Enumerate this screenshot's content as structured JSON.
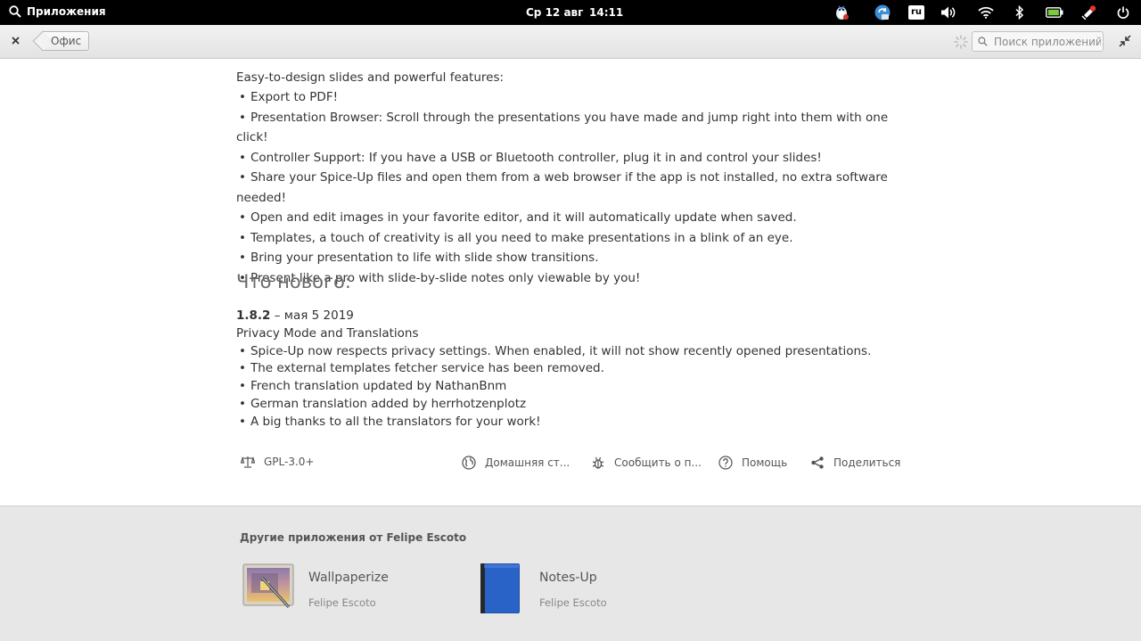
{
  "panel": {
    "apps_label": "Приложения",
    "date": "Ср 12 авг",
    "time": "14:11",
    "lang": "ru"
  },
  "header": {
    "back_label": "Офис",
    "search_placeholder": "Поиск приложений"
  },
  "description": {
    "intro": "Easy-to-design slides and powerful features:",
    "features": [
      "Export to PDF!",
      "Presentation Browser: Scroll through the presentations you have made and jump right into them with one click!",
      "Controller Support: If you have a USB or Bluetooth controller, plug it in and control your slides!",
      "Share your Spice-Up files and open them from a web browser if the app is not installed, no extra software needed!",
      "Open and edit images in your favorite editor, and it will automatically update when saved.",
      "Templates, a touch of creativity is all you need to make presentations in a blink of an eye.",
      "Bring your presentation to life with slide show transitions.",
      "Present like a pro with slide-by-slide notes only viewable by you!"
    ]
  },
  "whats_new": {
    "heading": "Что нового:",
    "version": "1.8.2",
    "date": " – мая  5 2019",
    "title": "Privacy Mode and Translations",
    "items": [
      "Spice-Up now respects privacy settings. When enabled, it will not show recently opened presentations.",
      "The external templates fetcher service has been removed.",
      "French translation updated by NathanBnm",
      "German translation added by herrhotzenplotz",
      "A big thanks to all the translators for your work!"
    ]
  },
  "links": {
    "license": "GPL-3.0+",
    "homepage": "Домашняя ст...",
    "report": "Сообщить о п...",
    "help": "Помощь",
    "share": "Поделиться"
  },
  "other_apps": {
    "title": "Другие приложения от Felipe Escoto",
    "apps": [
      {
        "name": "Wallpaperize",
        "author": "Felipe Escoto"
      },
      {
        "name": "Notes-Up",
        "author": "Felipe Escoto"
      }
    ]
  },
  "colors": {
    "panel_bg": "#000000",
    "notes_blue": "#2a63c8",
    "battery_green": "#7ac943",
    "notification_red": "#e5352b"
  }
}
